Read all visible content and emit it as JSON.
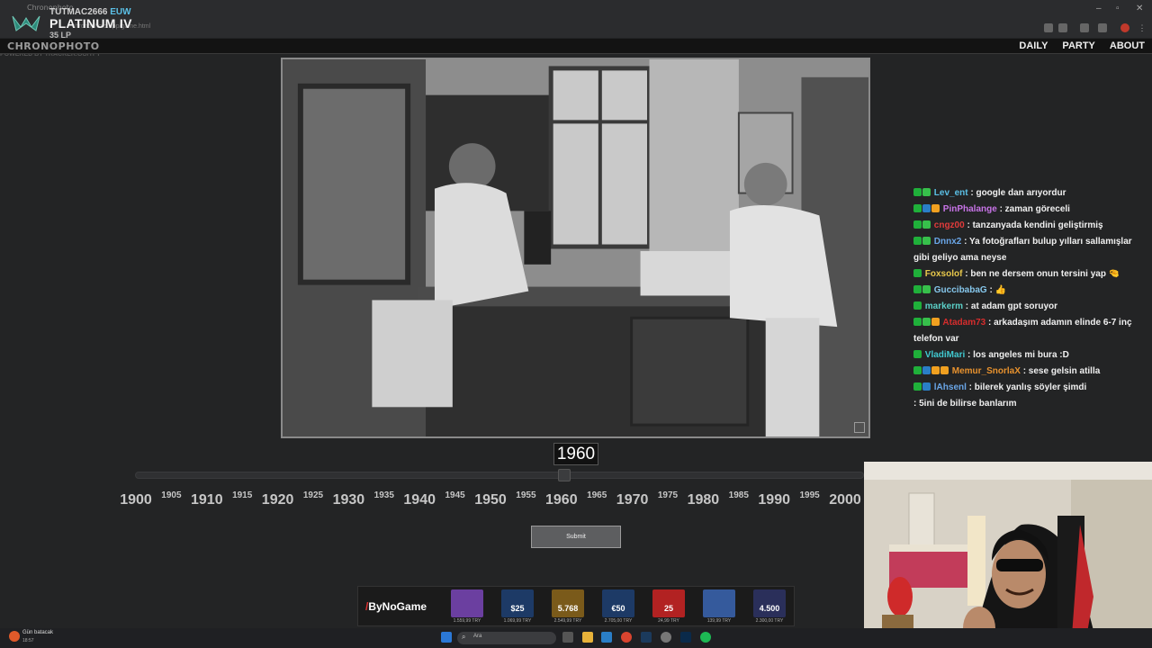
{
  "browser": {
    "tab_title": "Chronophoto",
    "url": "chronophoto.app/game.html"
  },
  "rank_overlay": {
    "summoner": "TUTMAC2666",
    "region": "EUW",
    "tier": "PLATINUM IV",
    "lp": "35 LP",
    "powered_by": "POWERED BY TRACKER.GG/TFT"
  },
  "site": {
    "logo": "CHRONOPHOTO",
    "nav": [
      "DAILY",
      "PARTY",
      "ABOUT"
    ]
  },
  "game": {
    "selected_year": "1960",
    "selected_fraction": 0.6,
    "ticks_major": [
      "1900",
      "1910",
      "1920",
      "1930",
      "1940",
      "1950",
      "1960",
      "1970",
      "1980",
      "1990",
      "2000"
    ],
    "ticks_minor": [
      "1905",
      "1915",
      "1925",
      "1935",
      "1945",
      "1955",
      "1965",
      "1975",
      "1985",
      "1995"
    ],
    "submit_label": "Submit"
  },
  "chat": [
    {
      "badges": [
        "#1fb03a",
        "#37c04b"
      ],
      "user": "Lev_ent",
      "color": "#5bc0e6",
      "text": "google dan arıyordur"
    },
    {
      "badges": [
        "#1fb03a",
        "#2a7ec7",
        "#f0a020"
      ],
      "user": "PinPhalange",
      "color": "#c874e8",
      "text": "zaman göreceli"
    },
    {
      "badges": [
        "#1fb03a",
        "#37c04b"
      ],
      "user": "cngz00",
      "color": "#e23b3b",
      "text": "tanzanyada kendini geliştirmiş"
    },
    {
      "badges": [
        "#1fb03a",
        "#37c04b"
      ],
      "user": "Dnnx2",
      "color": "#6aa6e8",
      "text": "Ya fotoğrafları bulup yılları sallamışlar gibi geliyo ama neyse"
    },
    {
      "badges": [
        "#1fb03a"
      ],
      "user": "Foxsolof",
      "color": "#e8c84b",
      "text": "ben ne dersem onun tersini yap 🤏"
    },
    {
      "badges": [
        "#1fb03a",
        "#37c04b"
      ],
      "user": "GuccibabaG",
      "color": "#86c7ec",
      "text": "👍"
    },
    {
      "badges": [
        "#1fb03a"
      ],
      "user": "markerm",
      "color": "#5bd0c8",
      "text": "at adam gpt soruyor"
    },
    {
      "badges": [
        "#1fb03a",
        "#37c04b",
        "#f0a020"
      ],
      "user": "Atadam73",
      "color": "#d72d2d",
      "text": "arkadaşım adamın elinde 6-7 inç telefon var"
    },
    {
      "badges": [
        "#1fb03a"
      ],
      "user": "VladiMari",
      "color": "#40c9d0",
      "text": "los angeles mi bura :D"
    },
    {
      "badges": [
        "#1fb03a",
        "#2a7ec7",
        "#f0a020",
        "#f0a020"
      ],
      "user": "Memur_SnorlaX",
      "color": "#e8922e",
      "text": "sese gelsin atilla"
    },
    {
      "badges": [
        "#1fb03a",
        "#2a7ec7"
      ],
      "user": "lAhsenl",
      "color": "#6aa6e8",
      "text": "bilerek yanlış söyler şimdi"
    },
    {
      "badges": [],
      "user": "",
      "color": "#ffffff",
      "text": "5ini de bilirse banlarım"
    }
  ],
  "ad": {
    "brand_prefix": "/",
    "brand": "ByNoGame",
    "items": [
      {
        "label": "",
        "color": "#6b3fa0",
        "price": "1.559,99 TRY"
      },
      {
        "label": "$25",
        "color": "#1d3a66",
        "price": "1.069,99 TRY"
      },
      {
        "label": "5.768",
        "color": "#7a5a1a",
        "price": "2.549,99 TRY"
      },
      {
        "label": "€50",
        "color": "#1d3a66",
        "price": "2.705,00 TRY"
      },
      {
        "label": "25",
        "color": "#b22222",
        "price": "24,99 TRY"
      },
      {
        "label": "",
        "color": "#355a9c",
        "price": "139,99 TRY"
      },
      {
        "label": "4.500",
        "color": "#2a2f5a",
        "price": "2.300,00 TRY"
      }
    ]
  },
  "taskbar": {
    "weather_label": "Gün batacak",
    "weather_time": "18:57",
    "search_placeholder": "Ara"
  }
}
